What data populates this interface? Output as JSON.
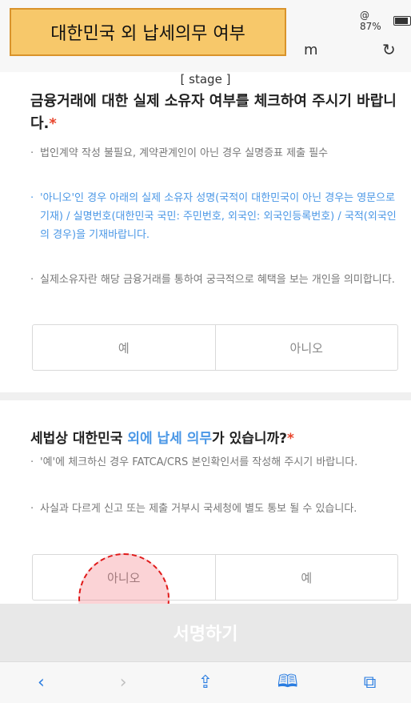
{
  "browser": {
    "battery": "@ 87%",
    "url_fragment": "m",
    "reload_icon": "reload-icon"
  },
  "callout": {
    "text": "대한민국 외 납세의무 여부"
  },
  "section1": {
    "stage": "[ stage ]",
    "question": "금융거래에 대한 실제 소유자 여부를 체크하여 주시기 바랍니다.",
    "required_mark": "*",
    "bullets": [
      "법인계약 작성 불필요, 계약관계인이 아닌 경우 실명증표 제출 필수",
      "'아니오'인 경우 아래의 실제 소유자 성명(국적이 대한민국이 아닌 경우는 영문으로 기재) / 실명번호(대한민국 국민: 주민번호, 외국인: 외국인등록번호) / 국적(외국인의 경우)을 기재바랍니다.",
      "실제소유자란 해당 금융거래를 통하여 궁극적으로 혜택을 보는 개인을 의미합니다."
    ],
    "option_yes": "예",
    "option_no": "아니오"
  },
  "section2": {
    "question_pre": "세법상 대한민국 ",
    "question_hl1": "외에",
    "question_hl2": "납세 의무",
    "question_post": "가 있습니까?",
    "required_mark": "*",
    "bullets": [
      "'예'에 체크하신 경우 FATCA/CRS 본인확인서를 작성해 주시기 바랍니다.",
      "사실과 다르게 신고 또는 제출 거부시 국세청에 별도 통보 될 수 있습니다."
    ],
    "option_no": "아니오",
    "option_yes": "예"
  },
  "sign_button": "서명하기",
  "toolbar": {
    "back": "‹",
    "forward": "›",
    "share": "⇪",
    "bookmarks": "🕮",
    "tabs": "⧉"
  },
  "colors": {
    "accent_blue": "#4a97e6",
    "required_red": "#e8452c",
    "callout_bg": "#f7c86a",
    "highlight_red": "#e01919"
  }
}
